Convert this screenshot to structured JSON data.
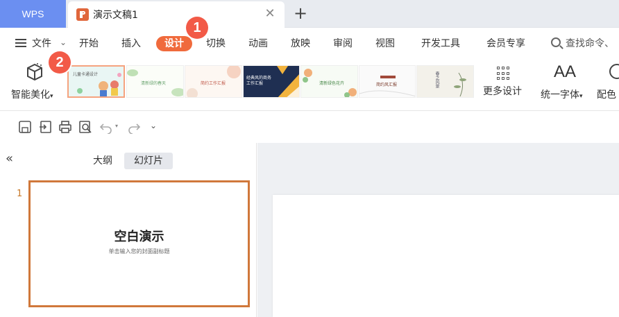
{
  "tabs": {
    "app": "WPS",
    "document": "演示文稿1",
    "close_icon": "close-icon",
    "new_tab_icon": "plus-icon"
  },
  "menu": {
    "file": "文件",
    "items": [
      "开始",
      "插入",
      "设计",
      "切换",
      "动画",
      "放映",
      "审阅",
      "视图",
      "开发工具",
      "会员专享"
    ],
    "active": "设计",
    "search_placeholder": "查找命令、"
  },
  "ribbon": {
    "smart_beautify": "智能美化",
    "more_design": "更多设计",
    "unify_font": "统一字体",
    "color_scheme": "配色",
    "templates": [
      {
        "text": "儿童卡通设计"
      },
      {
        "text": "清新绿的春天"
      },
      {
        "text": "简约工作汇报"
      },
      {
        "text": "经典风的商务工作汇报"
      },
      {
        "text": ""
      },
      {
        "text": "清新绿色花卉"
      },
      {
        "text": "简约风汇报"
      },
      {
        "text": "春之风景"
      }
    ],
    "accent": "#f06a3c"
  },
  "panel": {
    "outline": "大纲",
    "slides": "幻灯片",
    "slide_number": "1",
    "slide_title": "空白演示",
    "slide_subtitle": "单击输入您的封面副标题"
  },
  "annotations": {
    "step1": "1",
    "step2": "2"
  }
}
